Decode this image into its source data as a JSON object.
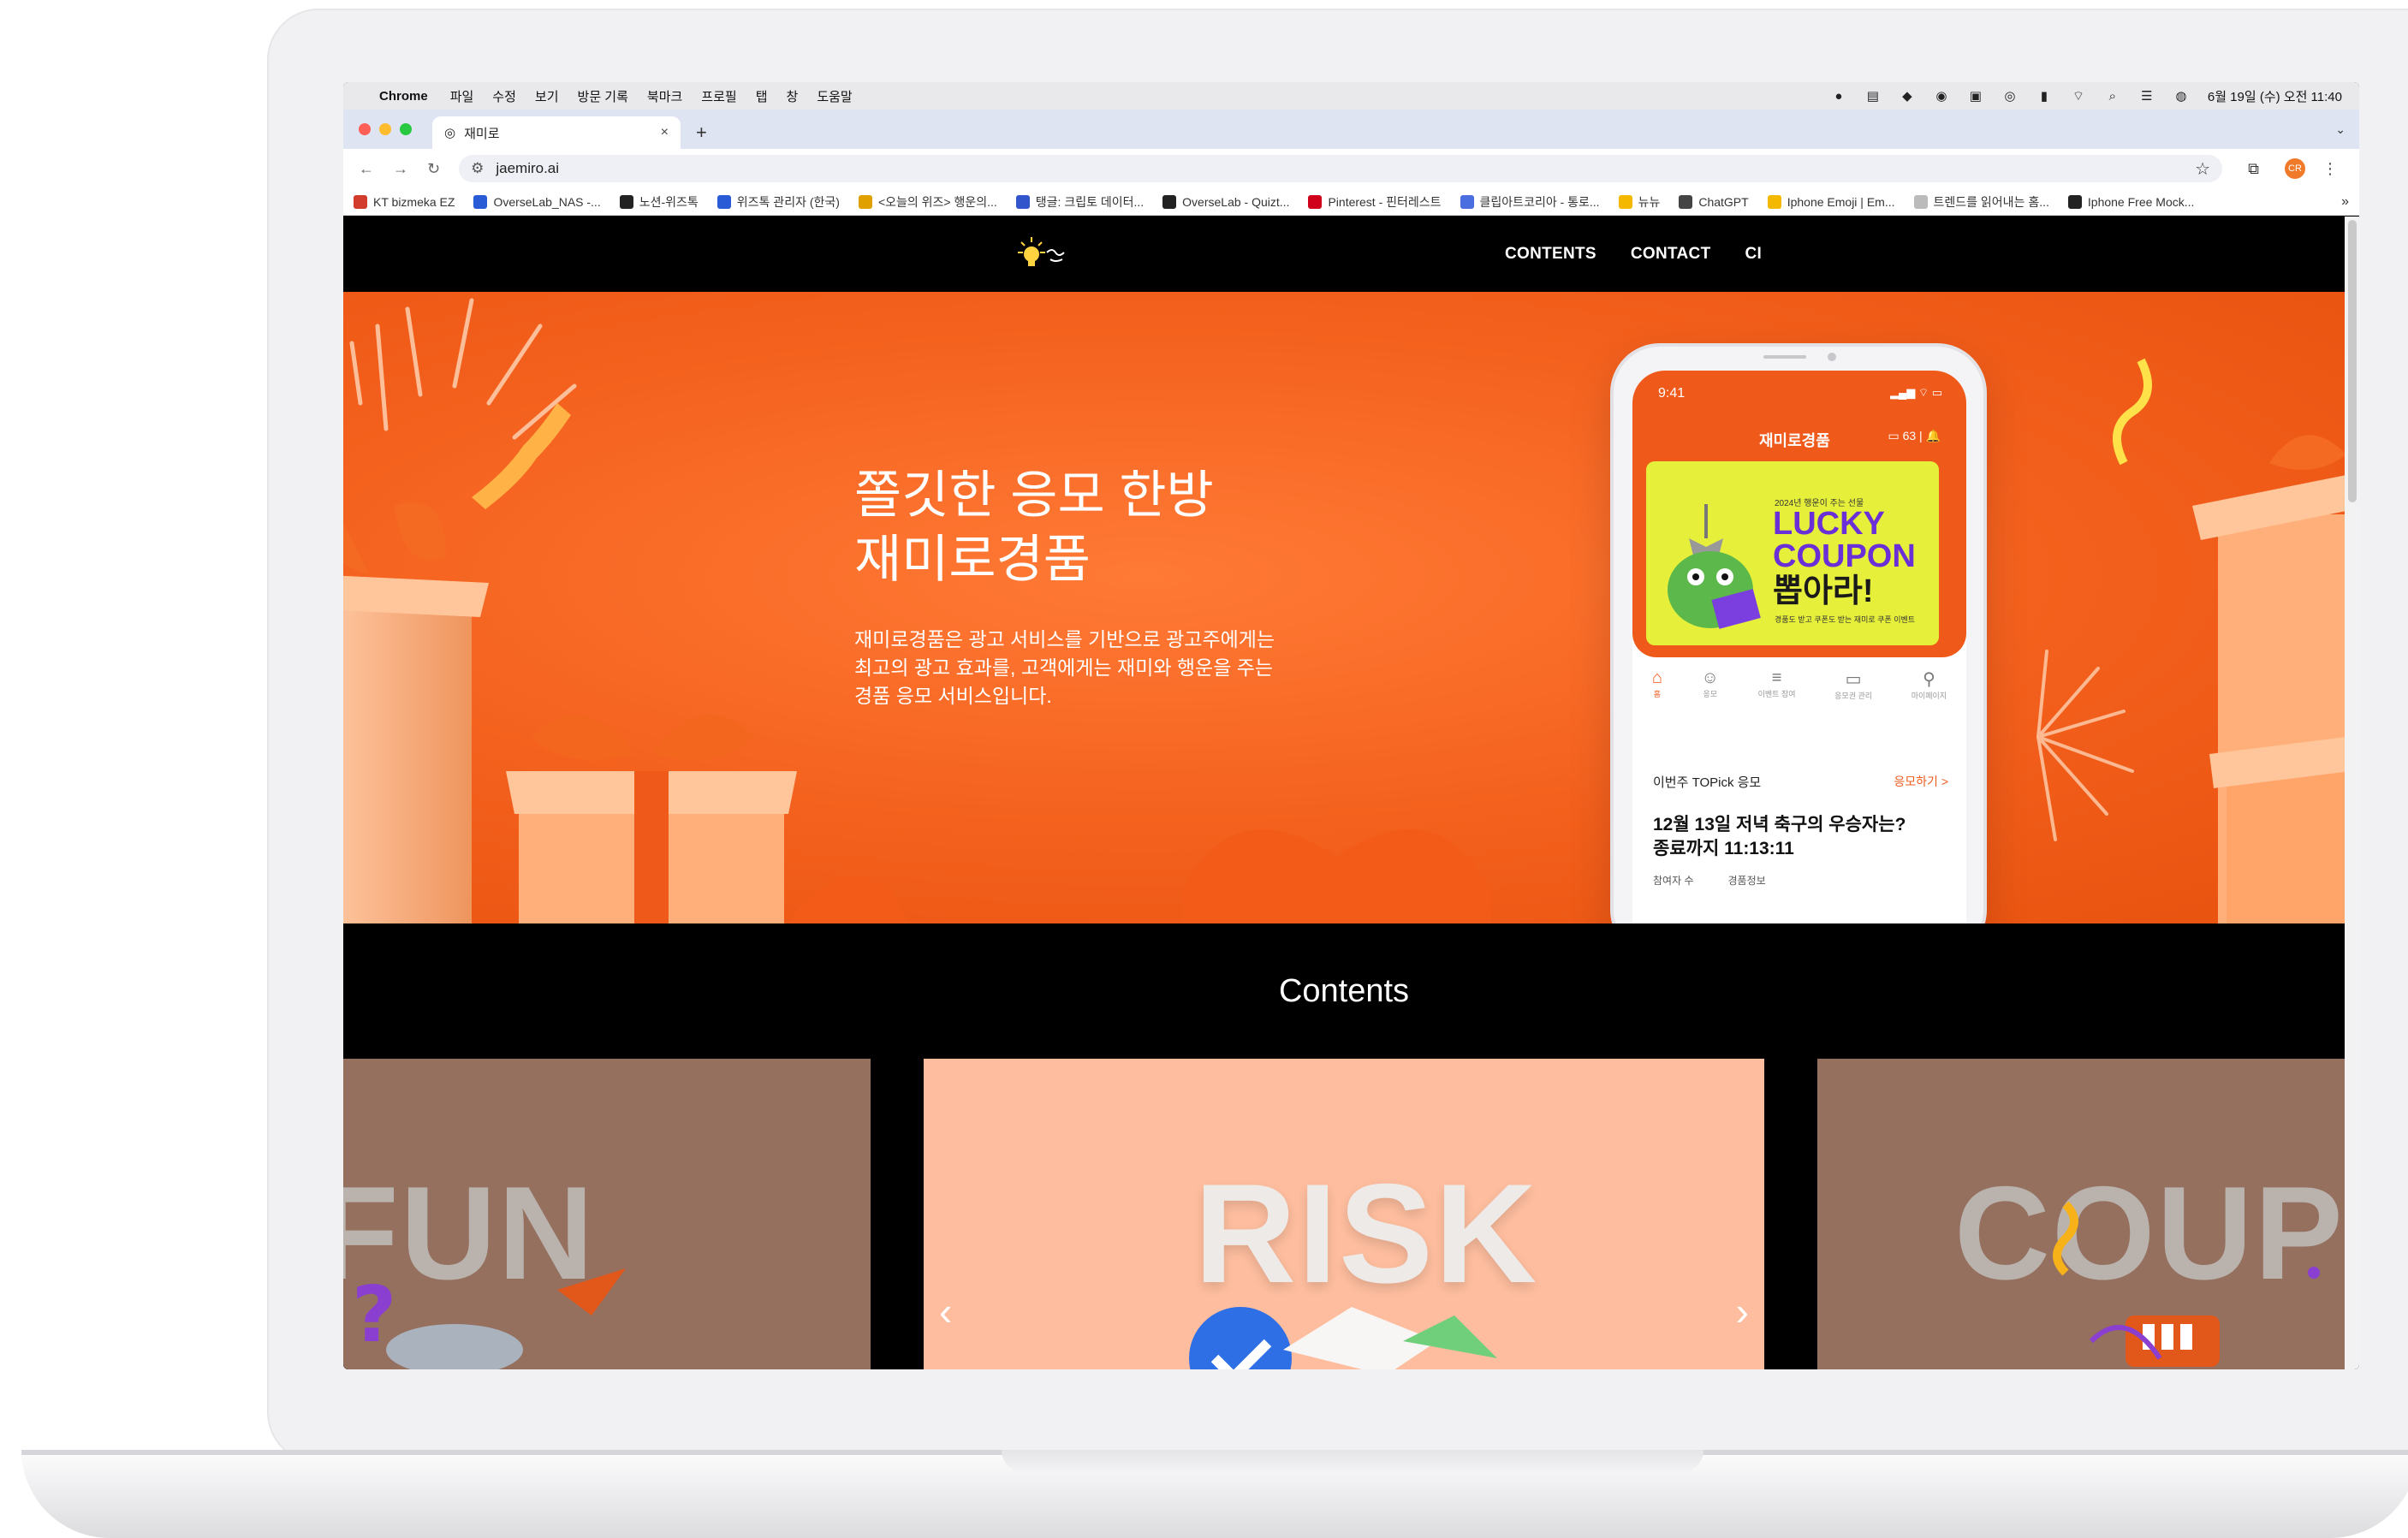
{
  "menubar": {
    "app_name": "Chrome",
    "menus": [
      "파일",
      "수정",
      "보기",
      "방문 기록",
      "북마크",
      "프로필",
      "탭",
      "창",
      "도움말"
    ],
    "datetime": "6월 19일 (수) 오전 11:40"
  },
  "browser": {
    "tab_title": "재미로",
    "url": "jaemiro.ai",
    "bookmarks": [
      {
        "label": "KT bizmeka EZ",
        "color": "#d23c2c"
      },
      {
        "label": "OverseLab_NAS -...",
        "color": "#2a5bd7"
      },
      {
        "label": "노션-위즈톡",
        "color": "#222222"
      },
      {
        "label": "위즈톡 관리자 (한국)",
        "color": "#2a5bd7"
      },
      {
        "label": "<오늘의 위즈> 행운의...",
        "color": "#e0a000"
      },
      {
        "label": "탱글: 크립토 데이터...",
        "color": "#3355cc"
      },
      {
        "label": "OverseLab - Quizt...",
        "color": "#222222"
      },
      {
        "label": "Pinterest - 핀터레스트",
        "color": "#d0021b"
      },
      {
        "label": "클립아트코리아 - 통로...",
        "color": "#4a6ee0"
      },
      {
        "label": "뉴뉴",
        "color": "#f5b800"
      },
      {
        "label": "ChatGPT",
        "color": "#444444"
      },
      {
        "label": "Iphone Emoji | Em...",
        "color": "#f5b800"
      },
      {
        "label": "트렌드를 읽어내는 홈...",
        "color": "#bbbbbb"
      },
      {
        "label": "Iphone Free Mock...",
        "color": "#222222"
      }
    ],
    "more_bookmarks": "»",
    "profile_initials": "CR"
  },
  "site": {
    "nav": [
      "CONTENTS",
      "CONTACT",
      "CI"
    ],
    "hero": {
      "title_line1": "쫄깃한 응모 한방",
      "title_line2": "재미로경품",
      "desc_line1": "재미로경품은 광고 서비스를 기반으로 광고주에게는",
      "desc_line2": "최고의 광고 효과를, 고객에게는 재미와 행운을 주는",
      "desc_line3": "경품 응모 서비스입니다."
    },
    "phone": {
      "time": "9:41",
      "app_title": "재미로경품",
      "counter": "63",
      "coupon_head": "2024년 행운이 주는 선물",
      "coupon_line1": "LUCKY",
      "coupon_line2": "COUPON",
      "coupon_line3": "뽑아라!",
      "coupon_small": "경품도 받고 쿠폰도 받는 재미로 쿠폰 이벤트",
      "tabs": [
        "홈",
        "응모",
        "이벤트 참여",
        "응모권 관리",
        "마이페이지"
      ],
      "section_title": "이번주 TOPick 응모",
      "section_link": "응모하기  >",
      "question_line1": "12월 13일 저녁 축구의 우승자는?",
      "question_line2": "종료까지 11:13:11",
      "meta_left": "참여자 수",
      "meta_right": "경품정보"
    },
    "contents_title": "Contents",
    "cards": [
      "FUN",
      "RISK",
      "COUPON"
    ],
    "arrow_prev": "‹",
    "arrow_next": "›"
  },
  "colors": {
    "brand_orange": "#f35f1c",
    "card_muted": "#95705f",
    "card_active": "#fdbd9e"
  }
}
